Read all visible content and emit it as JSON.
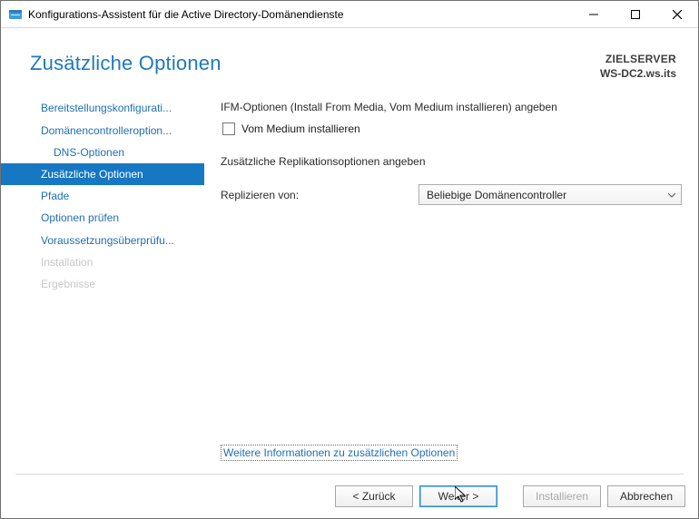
{
  "window": {
    "title": "Konfigurations-Assistent für die Active Directory-Domänendienste"
  },
  "header": {
    "page_title": "Zusätzliche Optionen",
    "target_label": "ZIELSERVER",
    "target_server": "WS-DC2.ws.its"
  },
  "nav": {
    "items": [
      {
        "label": "Bereitstellungskonfigurati...",
        "state": "normal",
        "indent": false
      },
      {
        "label": "Domänencontrolleroption...",
        "state": "normal",
        "indent": false
      },
      {
        "label": "DNS-Optionen",
        "state": "normal",
        "indent": true
      },
      {
        "label": "Zusätzliche Optionen",
        "state": "active",
        "indent": false
      },
      {
        "label": "Pfade",
        "state": "normal",
        "indent": false
      },
      {
        "label": "Optionen prüfen",
        "state": "normal",
        "indent": false
      },
      {
        "label": "Voraussetzungsüberprüfu...",
        "state": "normal",
        "indent": false
      },
      {
        "label": "Installation",
        "state": "disabled",
        "indent": false
      },
      {
        "label": "Ergebnisse",
        "state": "disabled",
        "indent": false
      }
    ]
  },
  "content": {
    "ifm_label": "IFM-Optionen (Install From Media, Vom Medium installieren) angeben",
    "ifm_checkbox_label": "Vom Medium installieren",
    "ifm_checked": false,
    "replication_heading": "Zusätzliche Replikationsoptionen angeben",
    "replicate_from_label": "Replizieren von:",
    "replicate_from_value": "Beliebige Domänencontroller",
    "more_link": "Weitere Informationen zu zusätzlichen Optionen"
  },
  "footer": {
    "back": "< Zurück",
    "next": "Weiter >",
    "install": "Installieren",
    "cancel": "Abbrechen"
  }
}
